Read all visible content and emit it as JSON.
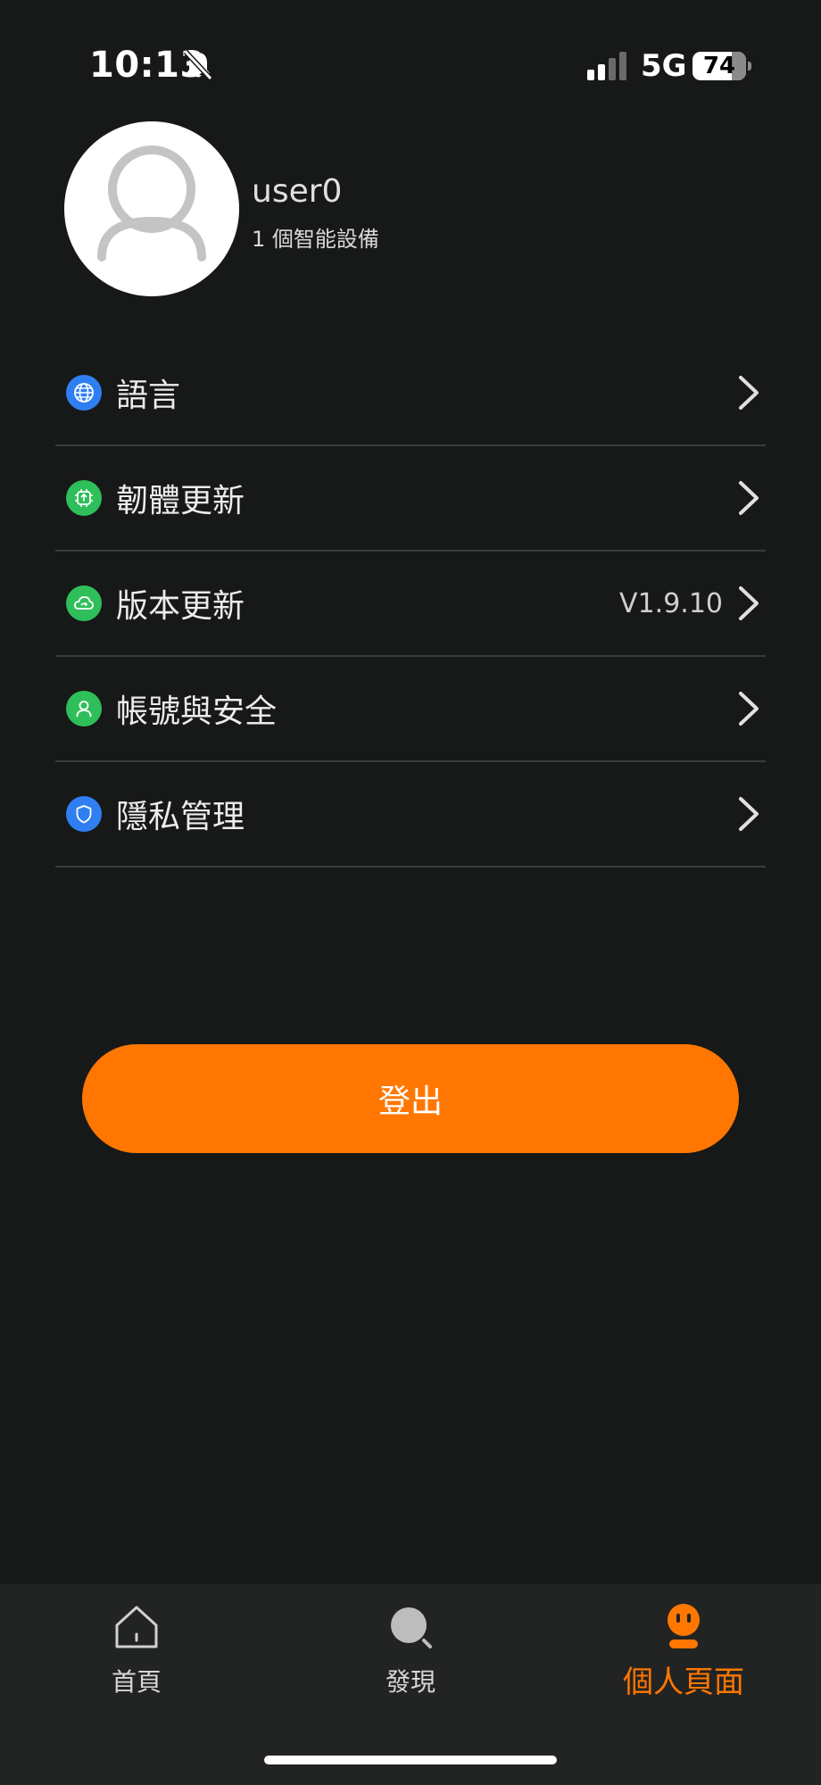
{
  "status_bar": {
    "time": "10:13",
    "network": "5G",
    "battery": "74"
  },
  "profile": {
    "username": "user0",
    "device_count": "1 個智能設備"
  },
  "menu": {
    "items": [
      {
        "label": "語言",
        "icon": "globe-icon",
        "icon_color": "#2f7ff2",
        "value": ""
      },
      {
        "label": "韌體更新",
        "icon": "chip-upload-icon",
        "icon_color": "#2fbf5a",
        "value": ""
      },
      {
        "label": "版本更新",
        "icon": "cloud-sync-icon",
        "icon_color": "#2fbf5a",
        "value": "V1.9.10"
      },
      {
        "label": "帳號與安全",
        "icon": "user-icon",
        "icon_color": "#2fbf5a",
        "value": ""
      },
      {
        "label": "隱私管理",
        "icon": "shield-icon",
        "icon_color": "#2f7ff2",
        "value": ""
      }
    ]
  },
  "logout": {
    "label": "登出",
    "color": "#ff7700"
  },
  "bottom_nav": {
    "items": [
      {
        "label": "首頁",
        "icon": "home-icon",
        "active": false
      },
      {
        "label": "發現",
        "icon": "discover-icon",
        "active": false
      },
      {
        "label": "個人頁面",
        "icon": "profile-face-icon",
        "active": true
      }
    ]
  },
  "colors": {
    "background": "#171818",
    "accent": "#ff7700",
    "nav_background": "#222323"
  }
}
